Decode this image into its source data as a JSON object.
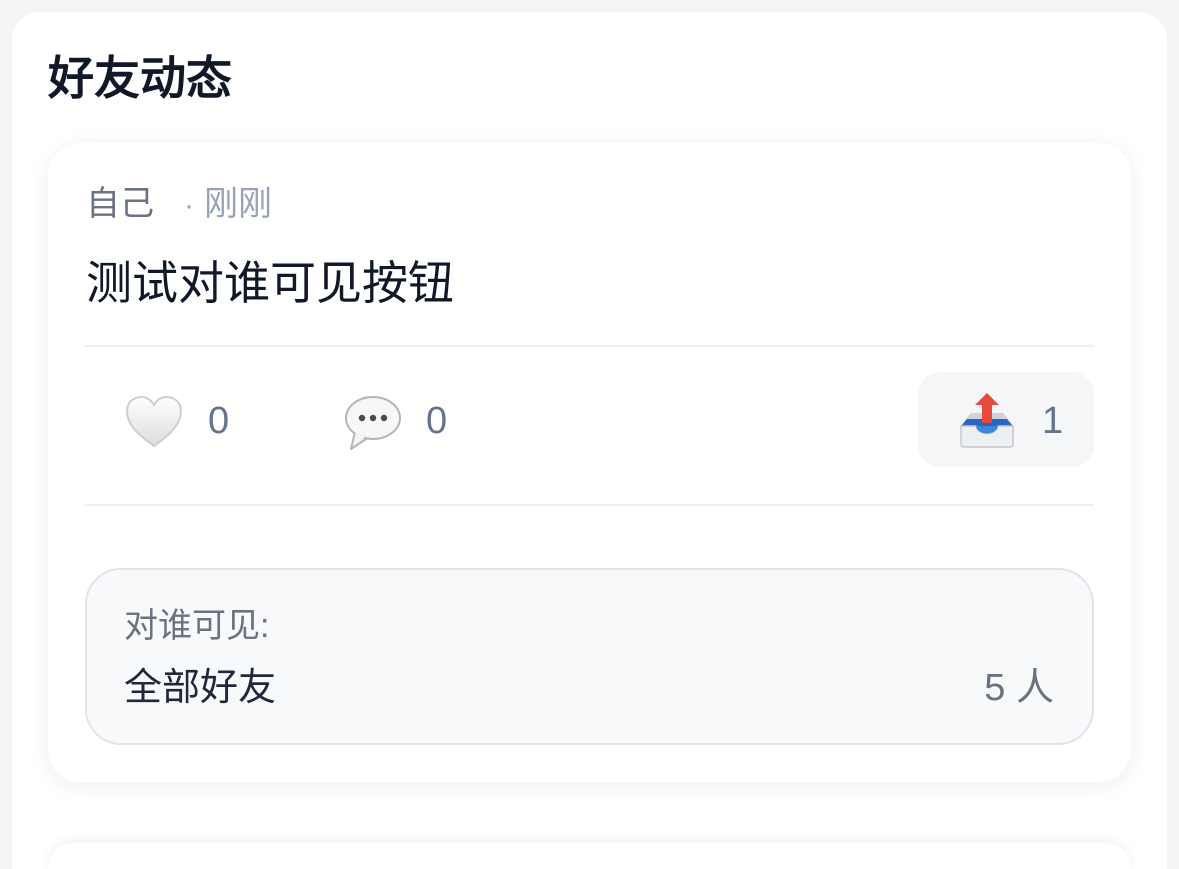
{
  "page": {
    "title": "好友动态"
  },
  "posts": [
    {
      "author": "自己",
      "separator": "·",
      "time": "刚刚",
      "content": "测试对谁可见按钮",
      "actions": {
        "like": {
          "icon": "heart-icon",
          "count": "0"
        },
        "comment": {
          "icon": "comment-icon",
          "count": "0"
        },
        "share": {
          "icon": "outbox-tray-icon",
          "count": "1"
        }
      },
      "visibility": {
        "label": "对谁可见:",
        "value": "全部好友",
        "count": "5 人"
      }
    }
  ],
  "colors": {
    "background": "#f4f5f7",
    "card": "#ffffff",
    "text_primary": "#111827",
    "text_secondary": "#6b7280",
    "text_muted": "#9aa3b6",
    "visibility_bg": "#f8f9fb",
    "visibility_border": "#e1e4ea"
  }
}
